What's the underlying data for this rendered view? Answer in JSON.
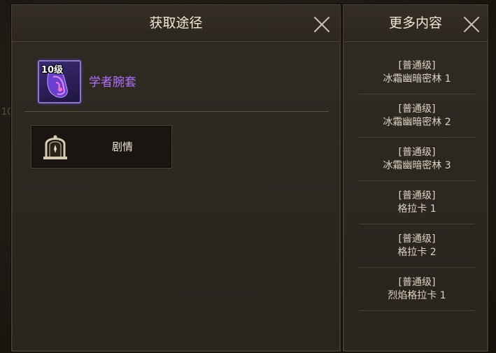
{
  "acquire_panel": {
    "title": "获取途径",
    "item": {
      "level": "10级",
      "name": "学者腕套",
      "icon": "purple-bracer-icon",
      "name_color": "#b070ff"
    },
    "sources": [
      {
        "label": "剧情",
        "icon": "story-gate-icon"
      }
    ]
  },
  "more_panel": {
    "title": "更多内容",
    "items": [
      {
        "grade": "[普通级]",
        "name": "冰霜幽暗密林 1"
      },
      {
        "grade": "[普通级]",
        "name": "冰霜幽暗密林 2"
      },
      {
        "grade": "[普通级]",
        "name": "冰霜幽暗密林 3"
      },
      {
        "grade": "[普通级]",
        "name": "格拉卡 1"
      },
      {
        "grade": "[普通级]",
        "name": "格拉卡 2"
      },
      {
        "grade": "[普通级]",
        "name": "烈焰格拉卡 1"
      }
    ]
  },
  "background": {
    "left_number": "10"
  }
}
